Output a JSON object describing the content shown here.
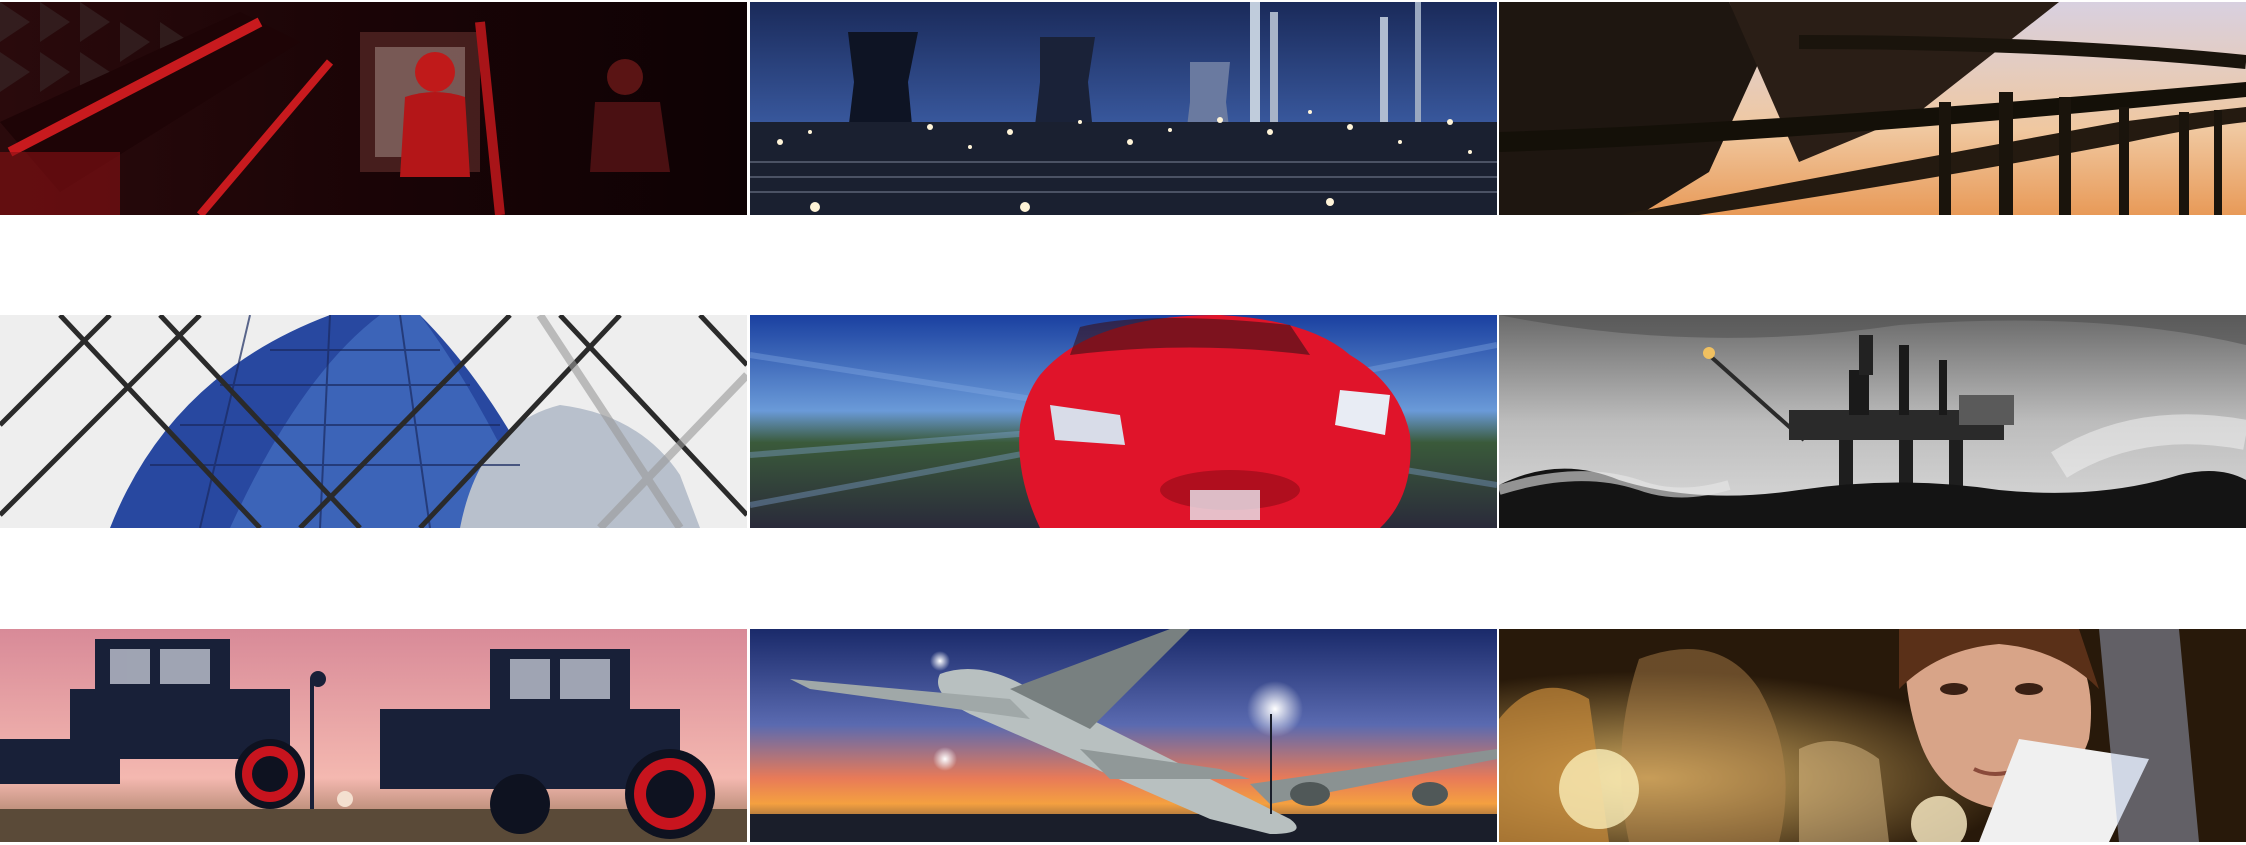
{
  "gallery": {
    "tiles": [
      {
        "row": 1,
        "col": 1,
        "subject": "crash-test-dummy-in-car",
        "colors": {
          "base": "#1a0608",
          "accent": "#b81418"
        }
      },
      {
        "row": 1,
        "col": 2,
        "subject": "industrial-refinery-at-night",
        "colors": {
          "sky": "#2a4a8a",
          "lights": "#e8f2ff"
        }
      },
      {
        "row": 1,
        "col": 3,
        "subject": "highway-overpass-at-sunset",
        "colors": {
          "sky": "#e8b890",
          "structure": "#1c1410"
        }
      },
      {
        "row": 2,
        "col": 1,
        "subject": "glass-building-through-skylight",
        "colors": {
          "sky": "#f2f2f2",
          "glass": "#2a4aa8"
        }
      },
      {
        "row": 2,
        "col": 2,
        "subject": "red-sports-car-motion-blur",
        "colors": {
          "car": "#e0142a",
          "sky": "#2a66c8"
        }
      },
      {
        "row": 2,
        "col": 3,
        "subject": "offshore-oil-platform-in-storm",
        "colors": {
          "sky": "#8a8a8a",
          "sea": "#1a1a1a"
        }
      },
      {
        "row": 3,
        "col": 1,
        "subject": "tractors-at-dusk",
        "colors": {
          "sky": "#e8a8a8",
          "tractor": "#182038"
        }
      },
      {
        "row": 3,
        "col": 2,
        "subject": "airplane-on-tarmac-at-sunset",
        "colors": {
          "sky": "#4a5aa8",
          "horizon": "#f08a3a"
        }
      },
      {
        "row": 3,
        "col": 3,
        "subject": "scientist-with-lab-glassware",
        "colors": {
          "glow": "#e8b060",
          "base": "#2a1a0a"
        }
      }
    ]
  }
}
